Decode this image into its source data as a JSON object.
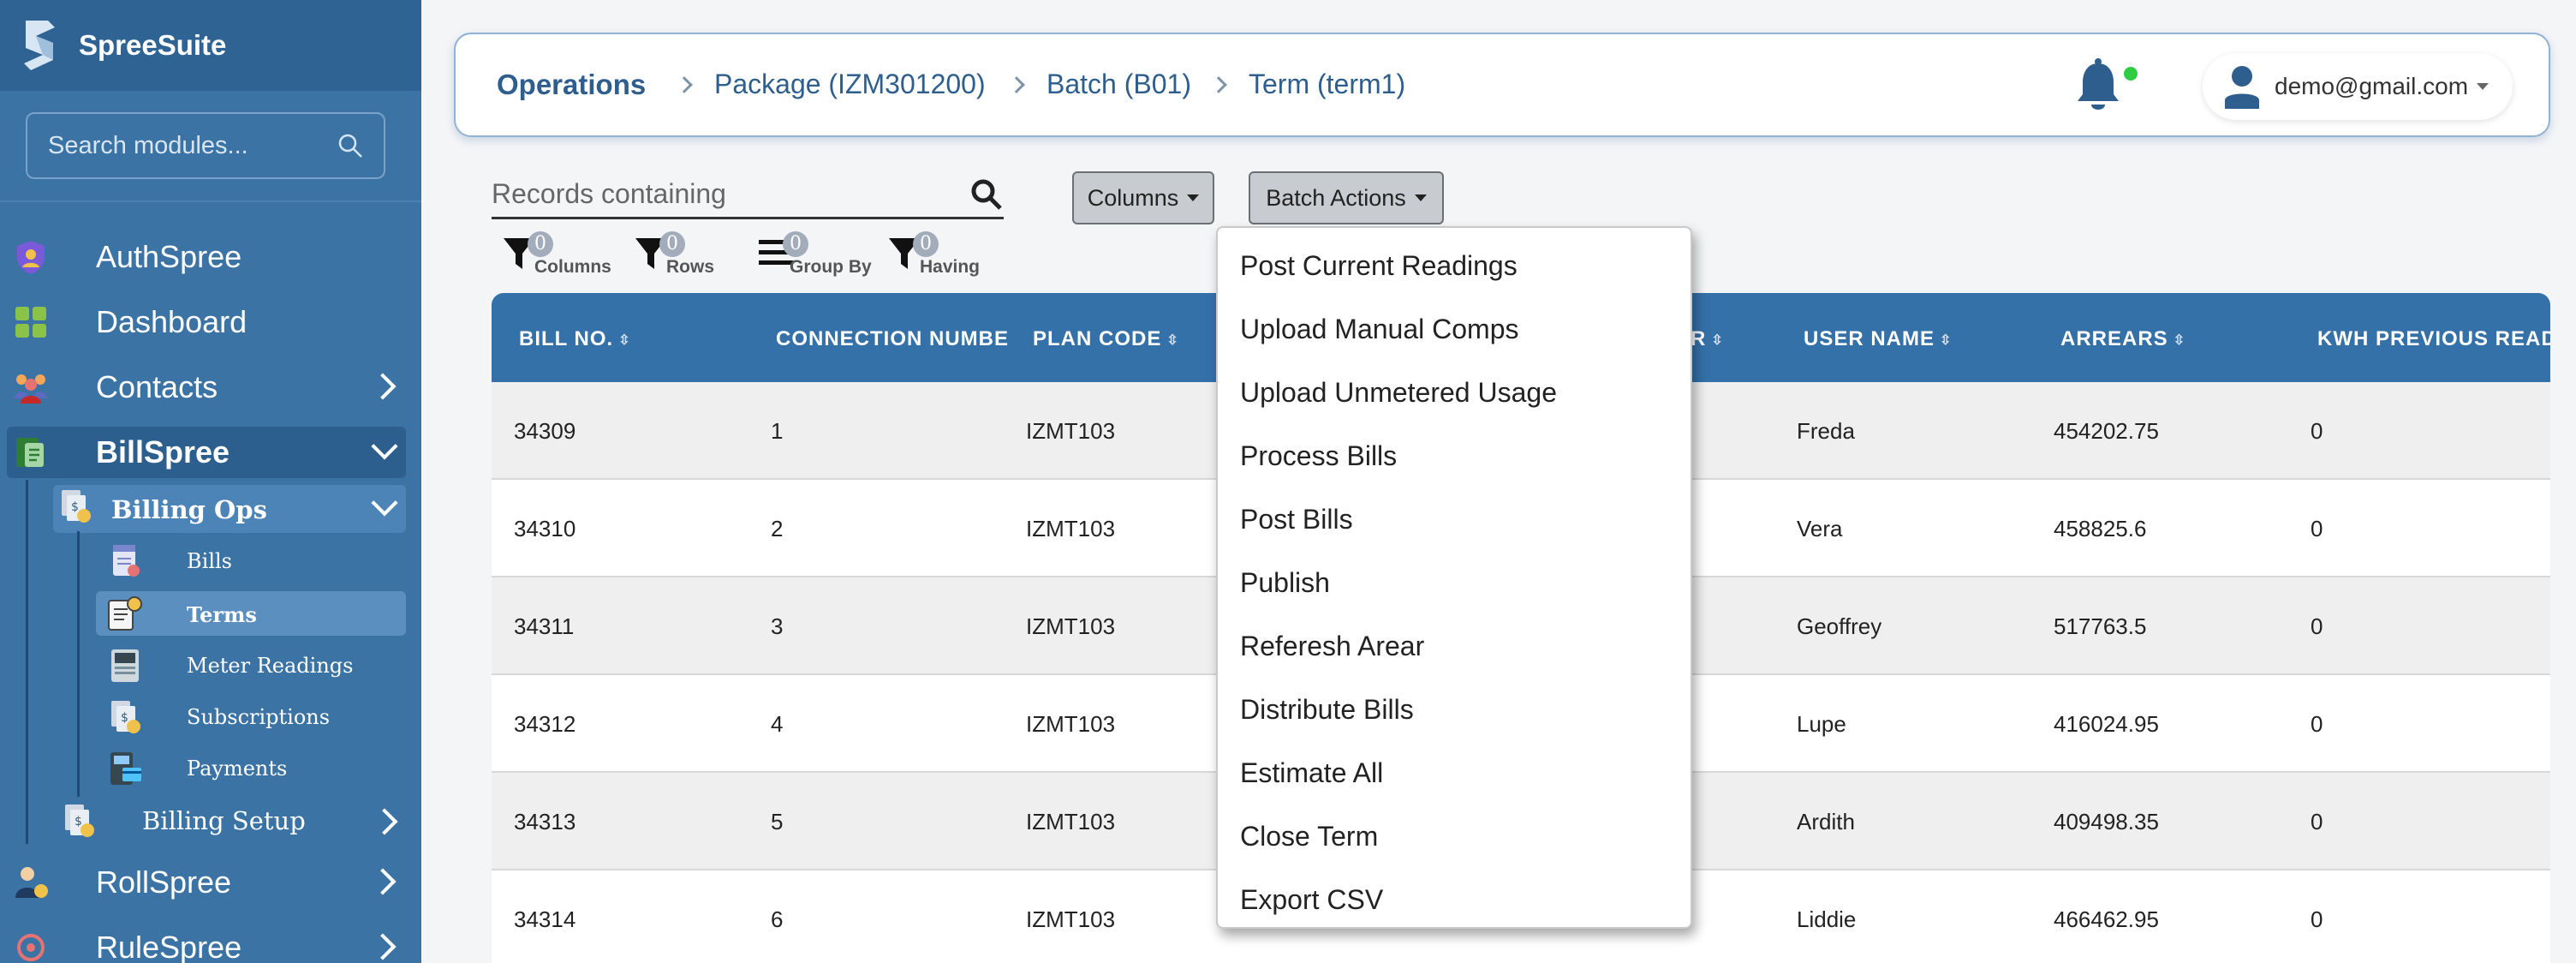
{
  "sidebar": {
    "brand": "SpreeSuite",
    "search_placeholder": "Search modules...",
    "items": [
      {
        "label": "AuthSpree"
      },
      {
        "label": "Dashboard"
      },
      {
        "label": "Contacts"
      },
      {
        "label": "BillSpree"
      },
      {
        "label": "RollSpree"
      },
      {
        "label": "RuleSpree"
      }
    ],
    "billing_ops": "Billing Ops",
    "billing_ops_items": [
      {
        "label": "Bills"
      },
      {
        "label": "Terms"
      },
      {
        "label": "Meter Readings"
      },
      {
        "label": "Subscriptions"
      },
      {
        "label": "Payments"
      }
    ],
    "billing_setup": "Billing Setup"
  },
  "header": {
    "breadcrumb": [
      "Operations",
      "Package (IZM301200)",
      "Batch (B01)",
      "Term (term1)"
    ],
    "user": "demo@gmail.com"
  },
  "toolbar": {
    "records_placeholder": "Records containing",
    "columns_label": "Columns",
    "batch_actions_label": "Batch Actions",
    "filters": [
      {
        "label": "Columns",
        "count": "0"
      },
      {
        "label": "Rows",
        "count": "0"
      },
      {
        "label": "Group By",
        "count": "0"
      },
      {
        "label": "Having",
        "count": "0"
      }
    ]
  },
  "batch_actions_menu": [
    "Post Current Readings",
    "Upload Manual Comps",
    "Upload Unmetered Usage",
    "Process Bills",
    "Post Bills",
    "Publish",
    "Referesh Arear",
    "Distribute Bills",
    "Estimate All",
    "Close Term",
    "Export CSV"
  ],
  "table": {
    "columns": [
      "BILL NO.",
      "CONNECTION NUMBER",
      "PLAN CODE",
      "R",
      "USER NAME",
      "ARREARS",
      "KWH PREVIOUS READING"
    ],
    "rows": [
      [
        "34309",
        "1",
        "IZMT103",
        "Freda",
        "454202.75",
        "0"
      ],
      [
        "34310",
        "2",
        "IZMT103",
        "Vera",
        "458825.6",
        "0"
      ],
      [
        "34311",
        "3",
        "IZMT103",
        "Geoffrey",
        "517763.5",
        "0"
      ],
      [
        "34312",
        "4",
        "IZMT103",
        "Lupe",
        "416024.95",
        "0"
      ],
      [
        "34313",
        "5",
        "IZMT103",
        "Ardith",
        "409498.35",
        "0"
      ],
      [
        "34314",
        "6",
        "IZMT103",
        "Liddie",
        "466462.95",
        "0"
      ]
    ]
  },
  "colors": {
    "sidebar": "#3b73a5",
    "header_accent": "#2d5e8e",
    "table_header": "#3471a8"
  }
}
